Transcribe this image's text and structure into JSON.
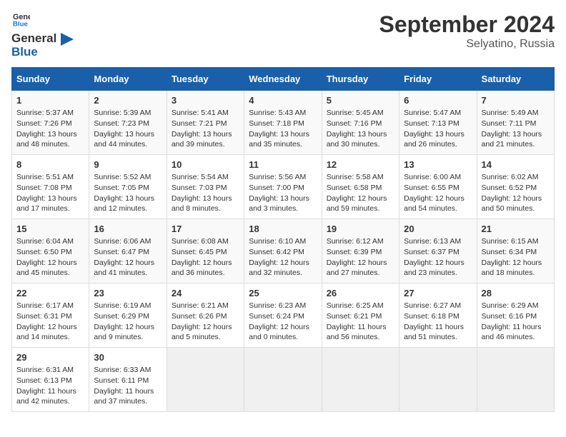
{
  "header": {
    "logo_line1": "General",
    "logo_line2": "Blue",
    "title": "September 2024",
    "subtitle": "Selyatino, Russia"
  },
  "days_of_week": [
    "Sunday",
    "Monday",
    "Tuesday",
    "Wednesday",
    "Thursday",
    "Friday",
    "Saturday"
  ],
  "weeks": [
    [
      {
        "day": "1",
        "sunrise": "5:37 AM",
        "sunset": "7:26 PM",
        "daylight": "13 hours and 48 minutes."
      },
      {
        "day": "2",
        "sunrise": "5:39 AM",
        "sunset": "7:23 PM",
        "daylight": "13 hours and 44 minutes."
      },
      {
        "day": "3",
        "sunrise": "5:41 AM",
        "sunset": "7:21 PM",
        "daylight": "13 hours and 39 minutes."
      },
      {
        "day": "4",
        "sunrise": "5:43 AM",
        "sunset": "7:18 PM",
        "daylight": "13 hours and 35 minutes."
      },
      {
        "day": "5",
        "sunrise": "5:45 AM",
        "sunset": "7:16 PM",
        "daylight": "13 hours and 30 minutes."
      },
      {
        "day": "6",
        "sunrise": "5:47 AM",
        "sunset": "7:13 PM",
        "daylight": "13 hours and 26 minutes."
      },
      {
        "day": "7",
        "sunrise": "5:49 AM",
        "sunset": "7:11 PM",
        "daylight": "13 hours and 21 minutes."
      }
    ],
    [
      {
        "day": "8",
        "sunrise": "5:51 AM",
        "sunset": "7:08 PM",
        "daylight": "13 hours and 17 minutes."
      },
      {
        "day": "9",
        "sunrise": "5:52 AM",
        "sunset": "7:05 PM",
        "daylight": "13 hours and 12 minutes."
      },
      {
        "day": "10",
        "sunrise": "5:54 AM",
        "sunset": "7:03 PM",
        "daylight": "13 hours and 8 minutes."
      },
      {
        "day": "11",
        "sunrise": "5:56 AM",
        "sunset": "7:00 PM",
        "daylight": "13 hours and 3 minutes."
      },
      {
        "day": "12",
        "sunrise": "5:58 AM",
        "sunset": "6:58 PM",
        "daylight": "12 hours and 59 minutes."
      },
      {
        "day": "13",
        "sunrise": "6:00 AM",
        "sunset": "6:55 PM",
        "daylight": "12 hours and 54 minutes."
      },
      {
        "day": "14",
        "sunrise": "6:02 AM",
        "sunset": "6:52 PM",
        "daylight": "12 hours and 50 minutes."
      }
    ],
    [
      {
        "day": "15",
        "sunrise": "6:04 AM",
        "sunset": "6:50 PM",
        "daylight": "12 hours and 45 minutes."
      },
      {
        "day": "16",
        "sunrise": "6:06 AM",
        "sunset": "6:47 PM",
        "daylight": "12 hours and 41 minutes."
      },
      {
        "day": "17",
        "sunrise": "6:08 AM",
        "sunset": "6:45 PM",
        "daylight": "12 hours and 36 minutes."
      },
      {
        "day": "18",
        "sunrise": "6:10 AM",
        "sunset": "6:42 PM",
        "daylight": "12 hours and 32 minutes."
      },
      {
        "day": "19",
        "sunrise": "6:12 AM",
        "sunset": "6:39 PM",
        "daylight": "12 hours and 27 minutes."
      },
      {
        "day": "20",
        "sunrise": "6:13 AM",
        "sunset": "6:37 PM",
        "daylight": "12 hours and 23 minutes."
      },
      {
        "day": "21",
        "sunrise": "6:15 AM",
        "sunset": "6:34 PM",
        "daylight": "12 hours and 18 minutes."
      }
    ],
    [
      {
        "day": "22",
        "sunrise": "6:17 AM",
        "sunset": "6:31 PM",
        "daylight": "12 hours and 14 minutes."
      },
      {
        "day": "23",
        "sunrise": "6:19 AM",
        "sunset": "6:29 PM",
        "daylight": "12 hours and 9 minutes."
      },
      {
        "day": "24",
        "sunrise": "6:21 AM",
        "sunset": "6:26 PM",
        "daylight": "12 hours and 5 minutes."
      },
      {
        "day": "25",
        "sunrise": "6:23 AM",
        "sunset": "6:24 PM",
        "daylight": "12 hours and 0 minutes."
      },
      {
        "day": "26",
        "sunrise": "6:25 AM",
        "sunset": "6:21 PM",
        "daylight": "11 hours and 56 minutes."
      },
      {
        "day": "27",
        "sunrise": "6:27 AM",
        "sunset": "6:18 PM",
        "daylight": "11 hours and 51 minutes."
      },
      {
        "day": "28",
        "sunrise": "6:29 AM",
        "sunset": "6:16 PM",
        "daylight": "11 hours and 46 minutes."
      }
    ],
    [
      {
        "day": "29",
        "sunrise": "6:31 AM",
        "sunset": "6:13 PM",
        "daylight": "11 hours and 42 minutes."
      },
      {
        "day": "30",
        "sunrise": "6:33 AM",
        "sunset": "6:11 PM",
        "daylight": "11 hours and 37 minutes."
      },
      null,
      null,
      null,
      null,
      null
    ]
  ]
}
